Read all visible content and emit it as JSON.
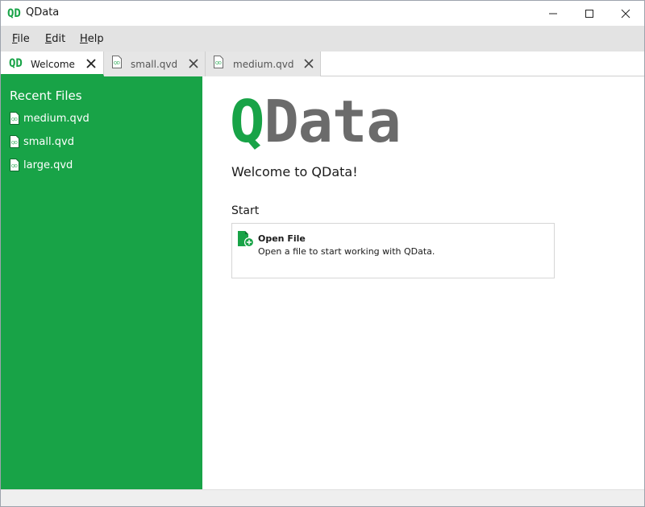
{
  "window": {
    "title": "QData",
    "app_logo_text": "QD"
  },
  "menu": {
    "items": [
      {
        "mnemonic": "F",
        "rest": "ile"
      },
      {
        "mnemonic": "E",
        "rest": "dit"
      },
      {
        "mnemonic": "H",
        "rest": "elp"
      }
    ]
  },
  "tabs": [
    {
      "label": "Welcome",
      "icon": "qdata-logo-icon",
      "active": true
    },
    {
      "label": "small.qvd",
      "icon": "qvd-file-icon",
      "active": false
    },
    {
      "label": "medium.qvd",
      "icon": "qvd-file-icon",
      "active": false
    }
  ],
  "sidebar": {
    "heading": "Recent Files",
    "items": [
      {
        "label": "medium.qvd",
        "icon": "qvd-file-icon"
      },
      {
        "label": "small.qvd",
        "icon": "qvd-file-icon"
      },
      {
        "label": "large.qvd",
        "icon": "qvd-file-icon"
      }
    ]
  },
  "main": {
    "logo_q": "Q",
    "logo_rest": "Data",
    "welcome": "Welcome to QData!",
    "start_heading": "Start",
    "start_actions": [
      {
        "title": "Open File",
        "description": "Open a file to start working with QData.",
        "icon": "open-file-icon"
      }
    ]
  },
  "colors": {
    "accent": "#18a347",
    "logo_gray": "#6b6b6b",
    "menubar_bg": "#e3e3e3",
    "inactive_tab_bg": "#e6e6e6"
  }
}
